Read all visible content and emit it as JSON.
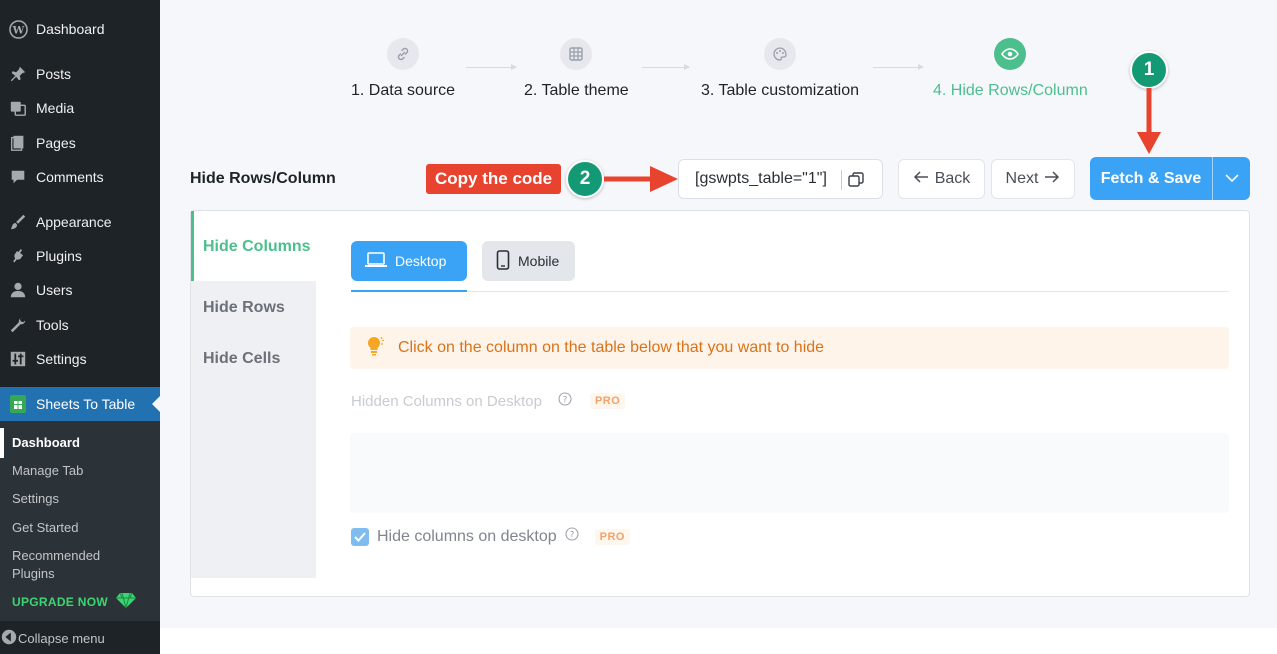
{
  "sidebar": {
    "items": [
      {
        "label": "Dashboard",
        "icon": "wordpress-icon"
      },
      {
        "label": "Posts",
        "icon": "pin-icon"
      },
      {
        "label": "Media",
        "icon": "media-icon"
      },
      {
        "label": "Pages",
        "icon": "pages-icon"
      },
      {
        "label": "Comments",
        "icon": "comment-icon"
      },
      {
        "label": "Appearance",
        "icon": "brush-icon"
      },
      {
        "label": "Plugins",
        "icon": "plug-icon"
      },
      {
        "label": "Users",
        "icon": "user-icon"
      },
      {
        "label": "Tools",
        "icon": "wrench-icon"
      },
      {
        "label": "Settings",
        "icon": "sliders-icon"
      },
      {
        "label": "Sheets To Table",
        "icon": "sheet-icon"
      }
    ],
    "submenu": [
      "Dashboard",
      "Manage Tab",
      "Settings",
      "Get Started",
      "Recommended Plugins"
    ],
    "upgrade": "UPGRADE NOW",
    "collapse": "Collapse menu"
  },
  "steps": [
    {
      "label": "1. Data source",
      "icon": "link-icon"
    },
    {
      "label": "2. Table theme",
      "icon": "grid-icon"
    },
    {
      "label": "3. Table customization",
      "icon": "palette-icon"
    },
    {
      "label": "4. Hide Rows/Column",
      "icon": "eye-icon"
    }
  ],
  "annotations": {
    "badge1": "1",
    "badge2": "2",
    "copy_tag": "Copy the code"
  },
  "toolbar": {
    "title": "Hide Rows/Column",
    "shortcode": "[gswpts_table=\"1\"]",
    "back": "Back",
    "next": "Next",
    "save": "Fetch & Save"
  },
  "vtabs": [
    "Hide Columns",
    "Hide Rows",
    "Hide Cells"
  ],
  "device_tabs": {
    "desktop": "Desktop",
    "mobile": "Mobile"
  },
  "notice": "Click on the column on the table below that you want to hide",
  "hidden_label": "Hidden Columns on Desktop",
  "pro": "PRO",
  "checkbox_label": "Hide columns on desktop",
  "colors": {
    "accent_blue": "#3ba3f5",
    "accent_green": "#4cbf8d",
    "annotation_red": "#e8432f",
    "badge_teal": "#139a74"
  }
}
